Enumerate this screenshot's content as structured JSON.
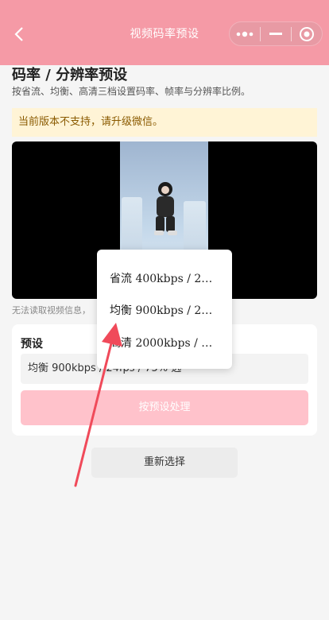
{
  "nav": {
    "title": "视频码率预设",
    "back_icon": "chevron-left-icon",
    "menu_icon": "more-dots-icon",
    "minimize_icon": "minus-icon",
    "close_icon": "target-circle-icon",
    "bg_color": "#f59aa6"
  },
  "header": {
    "title": "码率 / 分辨率预设",
    "subtitle": "按省流、均衡、高清三档设置码率、帧率与分辨率比例。"
  },
  "warning": {
    "text": "当前版本不支持，请升级微信。",
    "bg_color": "#fff4d6"
  },
  "video": {
    "note": "无法读取视频信息，"
  },
  "preset": {
    "label": "预设",
    "selected": "均衡 900kbps / 24fps / 75% 选",
    "process_button": "按预设处理",
    "options": [
      "省流 400kbps / 2…",
      "均衡 900kbps / 2…",
      "高清 2000kbps / …"
    ]
  },
  "reset_button": "重新选择",
  "annotation": {
    "color": "#f04a5a"
  }
}
